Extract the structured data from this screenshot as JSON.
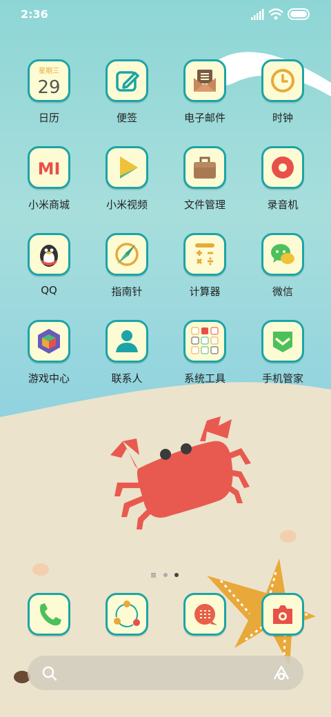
{
  "status_bar": {
    "time": "2:36"
  },
  "apps": [
    {
      "id": "calendar",
      "label": "日历",
      "icon": "calendar-icon",
      "weekday": "星期三",
      "day": "29"
    },
    {
      "id": "notes",
      "label": "便签",
      "icon": "notes-icon"
    },
    {
      "id": "email",
      "label": "电子邮件",
      "icon": "email-icon"
    },
    {
      "id": "clock",
      "label": "时钟",
      "icon": "clock-icon"
    },
    {
      "id": "mi-store",
      "label": "小米商城",
      "icon": "mi-icon",
      "glyph": "MI"
    },
    {
      "id": "mi-video",
      "label": "小米视频",
      "icon": "play-icon"
    },
    {
      "id": "file-manager",
      "label": "文件管理",
      "icon": "briefcase-icon"
    },
    {
      "id": "recorder",
      "label": "录音机",
      "icon": "record-icon"
    },
    {
      "id": "qq",
      "label": "QQ",
      "icon": "penguin-icon"
    },
    {
      "id": "compass",
      "label": "指南针",
      "icon": "compass-icon"
    },
    {
      "id": "calculator",
      "label": "计算器",
      "icon": "calculator-icon"
    },
    {
      "id": "wechat",
      "label": "微信",
      "icon": "wechat-icon"
    },
    {
      "id": "game-center",
      "label": "游戏中心",
      "icon": "cube-icon"
    },
    {
      "id": "contacts",
      "label": "联系人",
      "icon": "person-icon"
    },
    {
      "id": "system-tools",
      "label": "系统工具",
      "icon": "folder-grid-icon"
    },
    {
      "id": "security",
      "label": "手机管家",
      "icon": "shield-icon"
    }
  ],
  "dock": [
    {
      "id": "phone",
      "icon": "phone-icon"
    },
    {
      "id": "browser",
      "icon": "share-icon"
    },
    {
      "id": "messages",
      "icon": "message-icon"
    },
    {
      "id": "camera",
      "icon": "camera-icon"
    }
  ],
  "page_indicator": {
    "pages": 3,
    "current": 3
  },
  "colors": {
    "icon_bg": "#fdfbd4",
    "icon_border": "#1ba4a6",
    "sky": "#8ed6d6",
    "sand": "#ece3cc",
    "crab": "#e85a4f",
    "starfish": "#e8a93a"
  }
}
